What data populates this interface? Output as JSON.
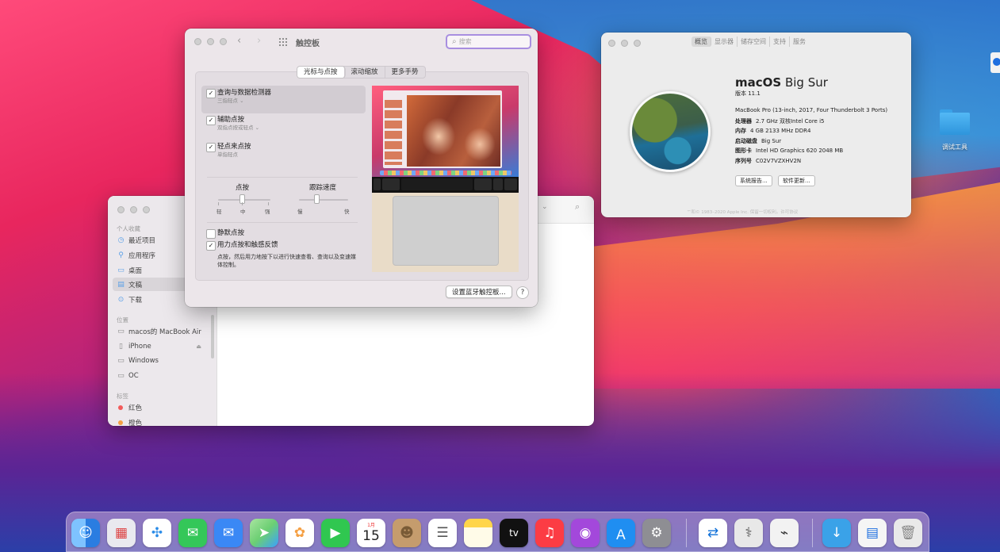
{
  "desktop": {
    "folder_label": "调试工具",
    "colors": {
      "accent": "#a88ee0",
      "folder": "#3aa2e8"
    }
  },
  "finder": {
    "sidebar": {
      "favorites_header": "个人收藏",
      "favorites": [
        {
          "label": "最近项目",
          "icon": "clock-icon"
        },
        {
          "label": "应用程序",
          "icon": "apps-icon"
        },
        {
          "label": "桌面",
          "icon": "desktop-icon"
        },
        {
          "label": "文稿",
          "icon": "document-icon"
        },
        {
          "label": "下载",
          "icon": "download-icon"
        }
      ],
      "locations_header": "位置",
      "locations": [
        {
          "label": "macos的 MacBook Air",
          "icon": "laptop-icon"
        },
        {
          "label": "iPhone",
          "icon": "phone-icon"
        },
        {
          "label": "Windows",
          "icon": "disk-icon"
        },
        {
          "label": "OC",
          "icon": "disk-icon"
        }
      ],
      "tags_header": "标签",
      "tags": [
        {
          "label": "红色",
          "color": "#f25b5b"
        },
        {
          "label": "橙色",
          "color": "#f5a044"
        }
      ]
    }
  },
  "trackpad": {
    "title": "触控板",
    "search_placeholder": "搜索",
    "tabs": [
      "光标与点按",
      "滚动缩放",
      "更多手势"
    ],
    "options": [
      {
        "label": "查询与数据检测器",
        "sub": "三指轻点 ⌄",
        "checked": "✓"
      },
      {
        "label": "辅助点按",
        "sub": "双指点按或轻点 ⌄",
        "checked": "✓"
      },
      {
        "label": "轻点来点按",
        "sub": "单指轻点",
        "checked": "✓"
      }
    ],
    "click_slider": {
      "label": "点按",
      "ticks": [
        "轻",
        "中",
        "强"
      ],
      "level": 0.5
    },
    "speed_slider": {
      "label": "跟踪速度",
      "ticks": [
        "慢",
        "快"
      ],
      "level": 0.35
    },
    "silent": {
      "label": "静默点按",
      "checked": ""
    },
    "force": {
      "label": "用力点按和触感反馈",
      "checked": "✓",
      "desc": "点按，然后用力地按下以进行快速查看、查询以及变速媒体控制。"
    },
    "bluetooth_button": "设置蓝牙触控板...",
    "help": "?"
  },
  "about": {
    "tabs": [
      "概览",
      "显示器",
      "储存空间",
      "支持",
      "服务"
    ],
    "os_name_bold": "macOS",
    "os_name_rest": " Big Sur",
    "version": "版本 11.1",
    "specs": [
      {
        "key": "",
        "value": "MacBook Pro (13-inch, 2017, Four Thunderbolt 3 Ports)"
      },
      {
        "key": "处理器",
        "value": "2.7 GHz 双核Intel Core i5"
      },
      {
        "key": "内存",
        "value": "4 GB 2133 MHz DDR4"
      },
      {
        "key": "启动磁盘",
        "value": "Big Sur"
      },
      {
        "key": "图形卡",
        "value": "Intel HD Graphics 620 2048 MB"
      },
      {
        "key": "序列号",
        "value": "C02V7VZXHV2N"
      }
    ],
    "report_button": "系统报告...",
    "update_button": "软件更新...",
    "footer": "™和© 1983–2020 Apple Inc. 保留一切权利。许可协议"
  },
  "dock": {
    "calendar_month": "1月",
    "calendar_day": "15",
    "tv_label": "tv",
    "apps": [
      {
        "name": "finder-icon",
        "color": "#3d8ef0"
      },
      {
        "name": "launchpad-icon",
        "color": "#e9e9ef"
      },
      {
        "name": "safari-icon",
        "color": "#2b8ce8"
      },
      {
        "name": "messages-icon",
        "color": "#34c759"
      },
      {
        "name": "mail-icon",
        "color": "#3a88f5"
      },
      {
        "name": "maps-icon",
        "color": "#6ccf73"
      },
      {
        "name": "photos-icon",
        "color": "#ffffff"
      },
      {
        "name": "facetime-icon",
        "color": "#30c750"
      },
      {
        "name": "calendar-icon",
        "color": "#ffffff"
      },
      {
        "name": "contacts-icon",
        "color": "#c59c6d"
      },
      {
        "name": "reminders-icon",
        "color": "#ffffff"
      },
      {
        "name": "notes-icon",
        "color": "#ffd54a"
      },
      {
        "name": "tv-icon",
        "color": "#111111"
      },
      {
        "name": "music-icon",
        "color": "#fc3c44"
      },
      {
        "name": "podcasts-icon",
        "color": "#a348db"
      },
      {
        "name": "appstore-icon",
        "color": "#1f8ef1"
      },
      {
        "name": "system-preferences-icon",
        "color": "#8e8e93"
      },
      {
        "name": "teamviewer-icon",
        "color": "#0e6fd8"
      },
      {
        "name": "system-information-icon",
        "color": "#e8e8e8"
      },
      {
        "name": "usb-tool-icon",
        "color": "#f2f2f2"
      },
      {
        "name": "downloads-folder-icon",
        "color": "#3aa2e8"
      },
      {
        "name": "documents-stack-icon",
        "color": "#f5f5f5"
      },
      {
        "name": "trash-icon",
        "color": "#e9e9e9"
      }
    ]
  }
}
